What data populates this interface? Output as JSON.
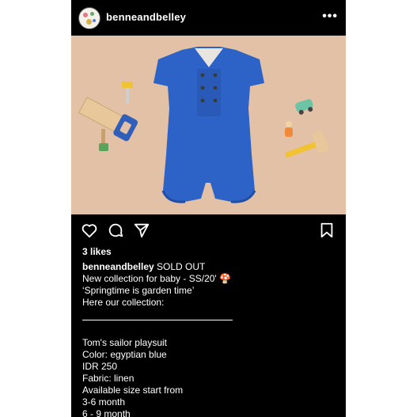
{
  "header": {
    "username": "benneandbelley",
    "more_label": "•••"
  },
  "post": {
    "image_alt": "Blue baby sailor playsuit with toy tools",
    "likes": "3 likes",
    "caption": {
      "username": "benneandbelley",
      "first_text": "SOLD OUT",
      "lines_a": [
        "New collection for baby - SS/20' 🍄",
        "‘Springtime is garden time’",
        "Here our collection:"
      ],
      "lines_b": [
        "Tom's sailor playsuit",
        "Color: egyptian blue",
        "IDR 250",
        "Fabric: linen",
        "Available size start from",
        "3-6 month",
        "6 - 9 month"
      ]
    }
  },
  "icons": {
    "like": "heart-icon",
    "comment": "comment-icon",
    "share": "paper-plane-icon",
    "save": "bookmark-icon"
  },
  "colors": {
    "background": "#000000",
    "text": "#ffffff",
    "photo_background": "#e3c1a6",
    "suit_blue": "#2d62c6"
  }
}
